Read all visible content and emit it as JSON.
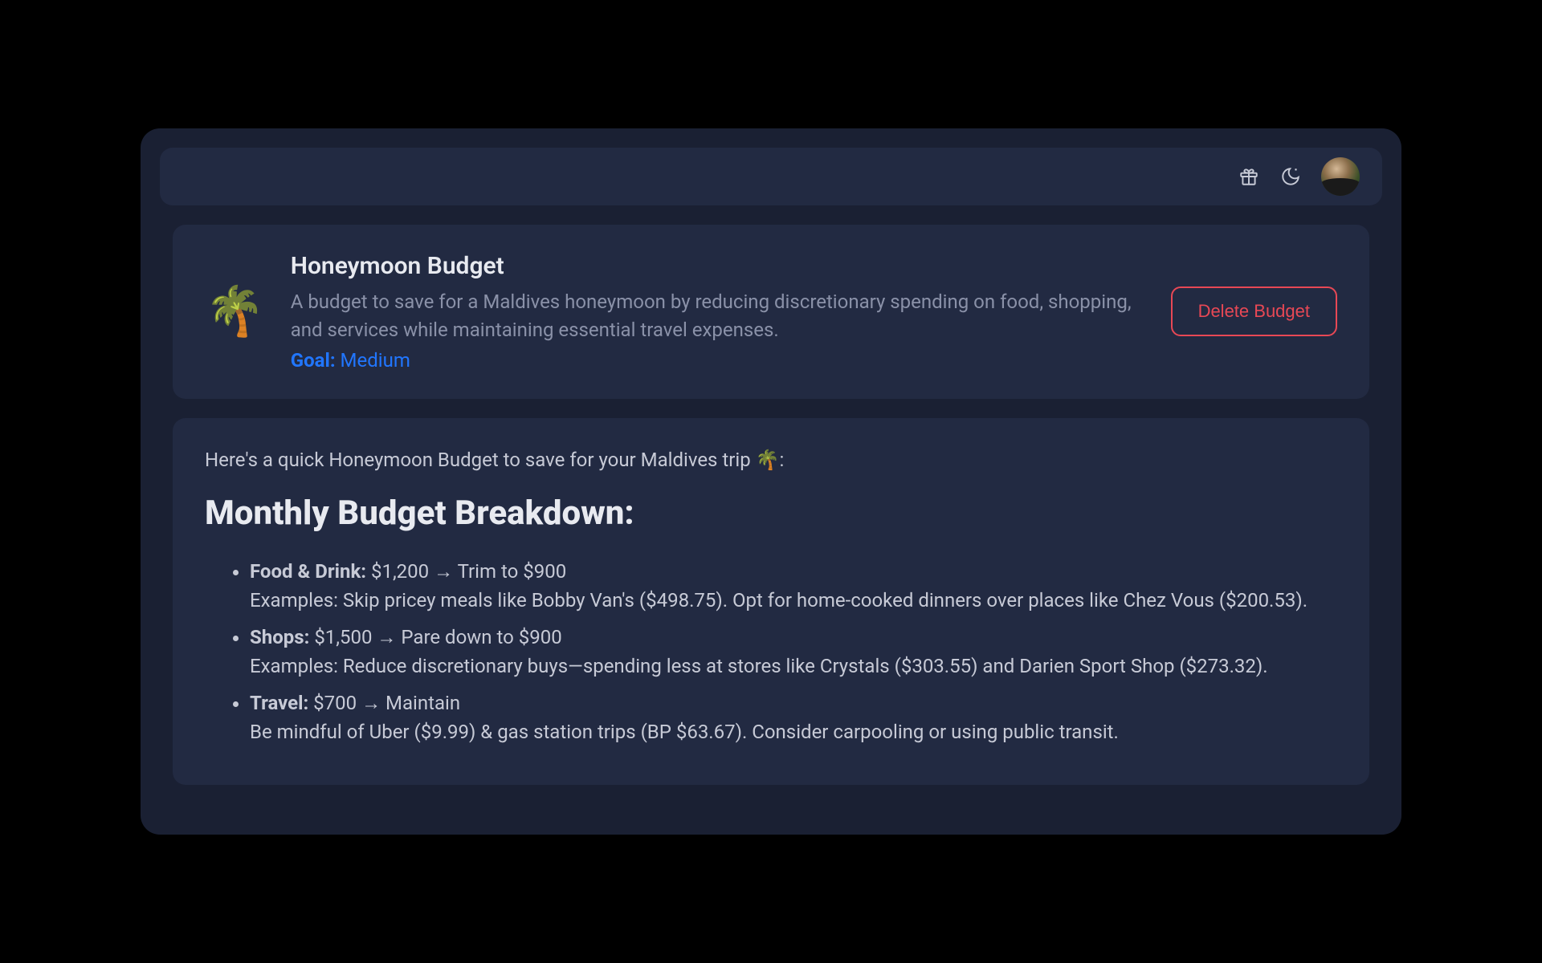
{
  "topbar": {
    "gift_icon": "gift-icon",
    "theme_icon": "moon-icon",
    "avatar": "user-avatar"
  },
  "budget": {
    "icon": "🌴",
    "title": "Honeymoon Budget",
    "description": "A budget to save for a Maldives honeymoon by reducing discretionary spending on food, shopping, and services while maintaining essential travel expenses.",
    "goal_label": "Goal:",
    "goal_value": "Medium",
    "delete_label": "Delete Budget"
  },
  "breakdown": {
    "intro": "Here's a quick Honeymoon Budget to save for your Maldives trip 🌴:",
    "heading": "Monthly Budget Breakdown:",
    "items": [
      {
        "label": "Food & Drink:",
        "change": " $1,200 → Trim to $900",
        "example": "Examples: Skip pricey meals like Bobby Van's ($498.75). Opt for home-cooked dinners over places like Chez Vous ($200.53)."
      },
      {
        "label": "Shops:",
        "change": " $1,500 → Pare down to $900",
        "example": "Examples: Reduce discretionary buys—spending less at stores like Crystals ($303.55) and Darien Sport Shop ($273.32)."
      },
      {
        "label": "Travel:",
        "change": " $700 → Maintain",
        "example": "Be mindful of Uber ($9.99) & gas station trips (BP $63.67). Consider carpooling or using public transit."
      }
    ]
  }
}
